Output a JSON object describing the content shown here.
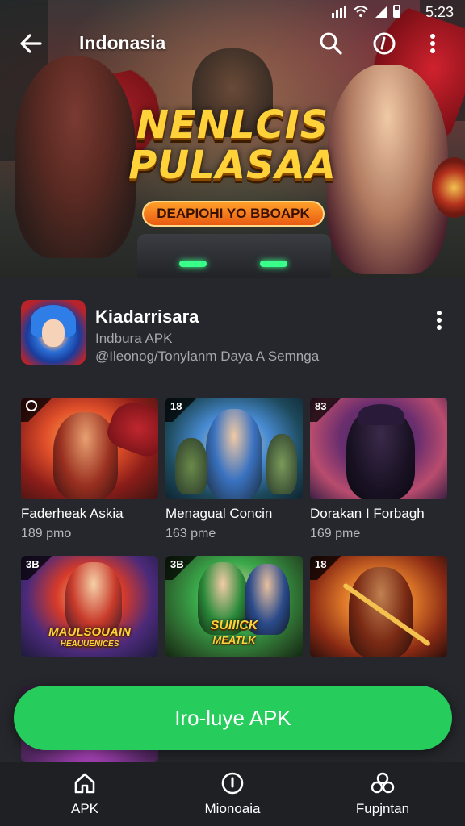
{
  "status_bar": {
    "time": "5:23"
  },
  "app_bar": {
    "title": "Indonasia"
  },
  "hero": {
    "logo_title_line1": "NENLCIS",
    "logo_title_line2": "PULASAA",
    "logo_subtitle": "DEAPIOHI YO BBOAPK"
  },
  "app": {
    "name": "Kiadarrisara",
    "type": "Indbura APK",
    "developer": "@Ileonog/Tonylanm Daya A Semnga"
  },
  "games": [
    {
      "title": "Faderheak Askia",
      "meta": "189 pmo",
      "badge": ""
    },
    {
      "title": "Menagual Concin",
      "meta": "163 pme",
      "badge": "18"
    },
    {
      "title": "Dorakan I Forbagh",
      "meta": "169 pme",
      "badge": "83"
    },
    {
      "title": "",
      "meta": "",
      "badge": "3B",
      "art_text_1": "MAULSOUAIN",
      "art_text_2": "HEAUUENICES"
    },
    {
      "title": "",
      "meta": "",
      "badge": "3B",
      "art_text_1": "SUIIICK",
      "art_text_2": "MEATLK"
    },
    {
      "title": "",
      "meta": "",
      "badge": "18"
    }
  ],
  "install_button": {
    "label": "Iro-luye APK"
  },
  "bottom_nav": [
    {
      "label": "APK",
      "icon": "home-icon"
    },
    {
      "label": "Mionoaia",
      "icon": "info-circle-icon"
    },
    {
      "label": "Fupjntan",
      "icon": "apps-cluster-icon"
    }
  ],
  "colors": {
    "accent": "#27cd5c",
    "background": "#26272c",
    "nav_background": "#1f2024",
    "secondary_text": "#a7a8ad"
  }
}
